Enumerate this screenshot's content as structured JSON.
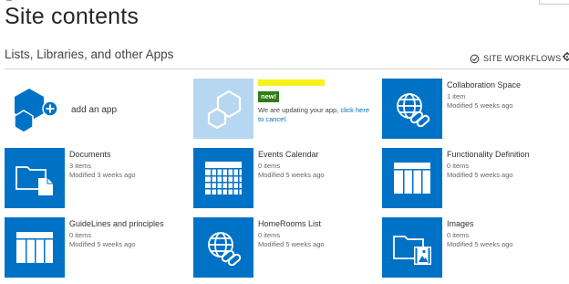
{
  "header": {
    "title": "Site contents"
  },
  "section": {
    "title": "Lists, Libraries, and other Apps",
    "workflows_label": "SITE WORKFLOWS"
  },
  "add_app": {
    "label": "add an app"
  },
  "pending_app": {
    "badge": "new!",
    "message": "We are updating your app, ",
    "cancel_link": "click here to cancel",
    "cancel_suffix": "."
  },
  "tiles": [
    {
      "name": "Collaboration Space",
      "count": "1 item",
      "modified": "Modified 5 weeks ago",
      "icon": "globe-link-icon"
    },
    {
      "name": "Documents",
      "count": "3 items",
      "modified": "Modified 3 weeks ago",
      "icon": "folder-document-icon"
    },
    {
      "name": "Events Calendar",
      "count": "0 items",
      "modified": "Modified 5 weeks ago",
      "icon": "calendar-icon"
    },
    {
      "name": "Functionality Definition",
      "count": "0 items",
      "modified": "Modified 5 weeks ago",
      "icon": "list-grid-icon"
    },
    {
      "name": "GuideLines and principles",
      "count": "0 items",
      "modified": "Modified 5 weeks ago",
      "icon": "list-grid-icon"
    },
    {
      "name": "HomeRooms List",
      "count": "0 items",
      "modified": "Modified 5 weeks ago",
      "icon": "globe-link-icon"
    },
    {
      "name": "Images",
      "count": "0 items",
      "modified": "Modified 5 weeks ago",
      "icon": "folder-image-icon"
    }
  ],
  "colors": {
    "tile_blue": "#0072c6",
    "pending_tile": "#b7d7f0",
    "badge_green": "#2e7d16",
    "highlight_yellow": "#f7f21a"
  }
}
